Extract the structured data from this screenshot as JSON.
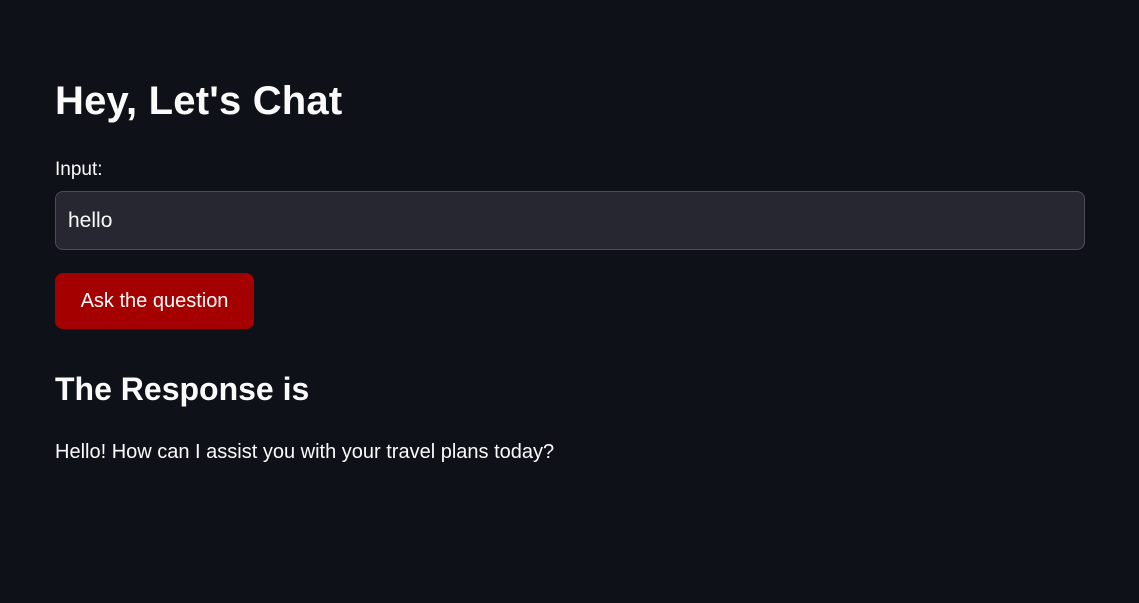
{
  "page": {
    "title": "Hey, Let's Chat"
  },
  "form": {
    "input_label": "Input:",
    "input_value": "hello",
    "button_label": "Ask the question"
  },
  "response": {
    "heading": "The Response is",
    "text": "Hello! How can I assist you with your travel plans today?"
  },
  "colors": {
    "background": "#0e1117",
    "text": "#fafafa",
    "input_background": "#262730",
    "input_border": "#4b4e56",
    "button_background": "#a50000"
  }
}
